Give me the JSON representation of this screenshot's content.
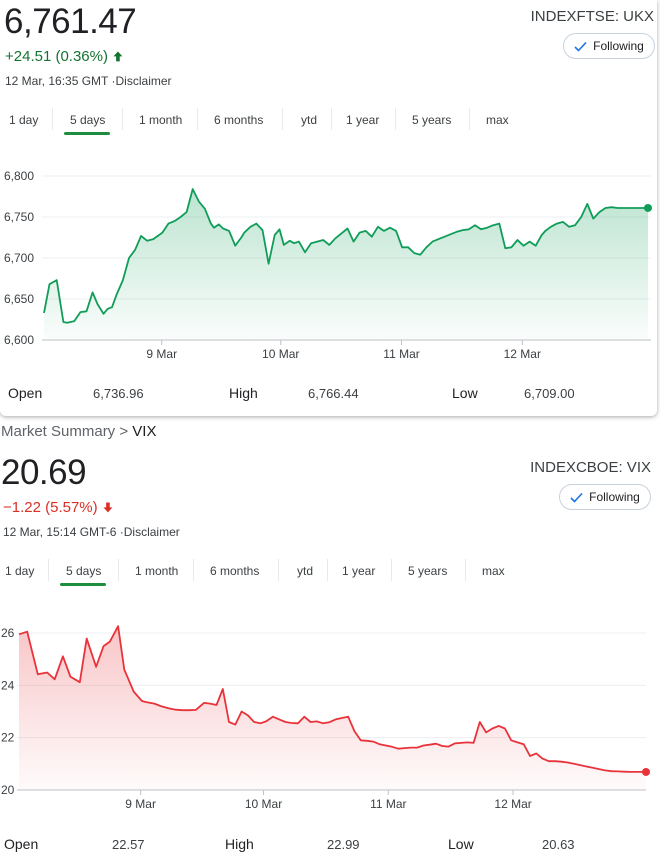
{
  "ukx": {
    "price": "6,761.47",
    "change": "+24.51 (0.36%)",
    "meta_time": "12 Mar, 16:35 GMT",
    "meta_sep": " ·",
    "meta_disclaimer": "Disclaimer",
    "ticker": "INDEXFTSE: UKX",
    "follow_label": "Following",
    "tabs": [
      "1 day",
      "5 days",
      "1 month",
      "6 months",
      "ytd",
      "1 year",
      "5 years",
      "max"
    ],
    "active_tab": "5 days",
    "stats": {
      "open_label": "Open",
      "open": "6,736.96",
      "high_label": "High",
      "high": "6,766.44",
      "low_label": "Low",
      "low": "6,709.00"
    },
    "colors": {
      "line": "#0f9d58",
      "text": "#137333"
    }
  },
  "breadcrumb": {
    "parent": "Market Summary",
    "sep": " > ",
    "current": "VIX"
  },
  "vix": {
    "price": "20.69",
    "change": "−1.22 (5.57%)",
    "meta_time": "12 Mar, 15:14 GMT-6",
    "meta_sep": " ·",
    "meta_disclaimer": "Disclaimer",
    "ticker": "INDEXCBOE: VIX",
    "follow_label": "Following",
    "tabs": [
      "1 day",
      "5 days",
      "1 month",
      "6 months",
      "ytd",
      "1 year",
      "5 years",
      "max"
    ],
    "active_tab": "5 days",
    "stats": {
      "open_label": "Open",
      "open": "22.57",
      "high_label": "High",
      "high": "22.99",
      "low_label": "Low",
      "low": "20.63"
    },
    "colors": {
      "line": "#e8333a",
      "text": "#d93025"
    }
  },
  "chart_data": [
    {
      "type": "line",
      "ylim": [
        6600,
        6800
      ],
      "yticks": [
        6600,
        6650,
        6700,
        6750,
        6800
      ],
      "ytick_labels": [
        "6,600",
        "6,650",
        "6,700",
        "6,750",
        "6,800"
      ],
      "xlim": [
        0,
        100
      ],
      "xticks": [
        19.4,
        39.0,
        58.9,
        78.8
      ],
      "xtick_labels": [
        "9 Mar",
        "10 Mar",
        "11 Mar",
        "12 Mar"
      ],
      "grid": true,
      "series": [
        {
          "x": [
            0,
            0.9,
            2.1,
            3.2,
            3.8,
            5.0,
            6.0,
            7.0,
            8.0,
            8.8,
            9.8,
            10.5,
            11.2,
            12.0,
            13.0,
            14.0,
            15.0,
            16.0,
            17.0,
            18.0,
            19.5,
            20.5,
            21.5,
            22.5,
            23.5,
            24.5,
            25.5,
            26.5,
            27.5,
            28.0,
            28.8,
            29.5,
            30.5,
            31.5,
            32.5,
            33.0,
            34.0,
            35.0,
            36.0,
            37.0,
            38.0,
            38.8,
            39.5,
            40.5,
            41.2,
            42.0,
            43.0,
            44.0,
            45.0,
            46.0,
            47.0,
            48.0,
            49.0,
            50.0,
            51.0,
            52.0,
            53.0,
            54.0,
            55.0,
            56.0,
            57.0,
            58.0,
            59.0,
            60.0,
            61.0,
            62.0,
            63.0,
            64.0,
            65.0,
            66.0,
            67.0,
            68.0,
            69.0,
            70.0,
            71.0,
            72.0,
            73.0,
            74.0,
            75.0,
            76.0,
            77.0,
            78.0,
            79.0,
            80.0,
            81.0,
            82.0,
            82.6,
            83.5,
            84.5,
            85.5,
            86.5,
            87.5,
            88.5,
            89.5,
            90.5,
            91.5,
            92.5,
            93.5,
            94.5,
            95.5,
            96.5,
            97.5,
            98.5,
            99.5
          ],
          "y": [
            6633,
            6668,
            6673,
            6622,
            6621,
            6623,
            6634,
            6635,
            6658,
            6644,
            6632,
            6638,
            6640,
            6656,
            6673,
            6700,
            6710,
            6727,
            6721,
            6723,
            6731,
            6742,
            6745,
            6750,
            6756,
            6784,
            6769,
            6760,
            6742,
            6737,
            6741,
            6736,
            6733,
            6715,
            6725,
            6731,
            6738,
            6742,
            6734,
            6693,
            6728,
            6735,
            6716,
            6721,
            6718,
            6720,
            6707,
            6718,
            6720,
            6722,
            6716,
            6724,
            6730,
            6736,
            6720,
            6731,
            6733,
            6726,
            6738,
            6733,
            6737,
            6733,
            6713,
            6713,
            6706,
            6704,
            6713,
            6720,
            6723,
            6726,
            6729,
            6732,
            6734,
            6735,
            6740,
            6735,
            6737,
            6740,
            6742,
            6712,
            6713,
            6722,
            6715,
            6720,
            6715,
            6728,
            6733,
            6738,
            6742,
            6744,
            6738,
            6740,
            6750,
            6766,
            6748,
            6756,
            6761,
            6762,
            6761,
            6761,
            6761,
            6761,
            6761,
            6761
          ],
          "end_marker": true
        }
      ]
    },
    {
      "type": "area",
      "ylim": [
        20,
        26
      ],
      "yticks": [
        20,
        22,
        24,
        26
      ],
      "ytick_labels": [
        "20",
        "22",
        "24",
        "26"
      ],
      "xlim": [
        0,
        100
      ],
      "xticks": [
        19.4,
        39.0,
        58.9,
        78.8
      ],
      "xtick_labels": [
        "9 Mar",
        "10 Mar",
        "11 Mar",
        "12 Mar"
      ],
      "grid": true,
      "series": [
        {
          "x": [
            0,
            1.3,
            3.0,
            4.5,
            5.7,
            7.0,
            8.2,
            9.7,
            10.8,
            12.3,
            13.5,
            14.5,
            15.8,
            16.8,
            18.3,
            19.6,
            20.3,
            21.6,
            22.7,
            23.9,
            25.0,
            26.1,
            27.2,
            28.2,
            29.5,
            30.5,
            31.5,
            32.5,
            33.5,
            34.5,
            35.5,
            36.5,
            37.5,
            38.5,
            39.4,
            40.5,
            41.5,
            42.5,
            43.5,
            44.5,
            45.5,
            46.5,
            47.5,
            48.5,
            49.5,
            50.5,
            51.5,
            52.5,
            53.5,
            54.5,
            55.5,
            56.5,
            57.5,
            58.5,
            59.5,
            60.5,
            61.5,
            62.5,
            63.5,
            64.5,
            65.5,
            66.5,
            67.5,
            68.5,
            69.5,
            70.5,
            71.5,
            72.5,
            73.5,
            74.5,
            75.5,
            76.5,
            77.5,
            78.5,
            79.5,
            80.5,
            81.5,
            82.5,
            83.5,
            84.5,
            85.5,
            86.5,
            87.5,
            88.5,
            89.5,
            90.5,
            91.5,
            92.5,
            93.5,
            94.5,
            95.5,
            96.5,
            97.5,
            98.5,
            99.5,
            100.0
          ],
          "y": [
            25.95,
            26.05,
            24.42,
            24.49,
            24.23,
            25.11,
            24.33,
            24.12,
            25.79,
            24.71,
            25.5,
            25.67,
            26.26,
            24.6,
            23.76,
            23.4,
            23.36,
            23.3,
            23.2,
            23.12,
            23.07,
            23.05,
            23.05,
            23.06,
            23.33,
            23.3,
            23.25,
            23.86,
            22.6,
            22.5,
            23.0,
            22.85,
            22.6,
            22.55,
            22.62,
            22.8,
            22.7,
            22.6,
            22.56,
            22.55,
            22.8,
            22.6,
            22.62,
            22.55,
            22.59,
            22.7,
            22.75,
            22.8,
            22.25,
            21.9,
            21.88,
            21.85,
            21.75,
            21.7,
            21.65,
            21.58,
            21.6,
            21.62,
            21.62,
            21.7,
            21.73,
            21.77,
            21.68,
            21.66,
            21.78,
            21.8,
            21.82,
            21.8,
            22.6,
            22.2,
            22.35,
            22.45,
            22.35,
            21.9,
            21.82,
            21.75,
            21.3,
            21.4,
            21.2,
            21.1,
            21.1,
            21.08,
            21.05,
            21.0,
            20.95,
            20.9,
            20.85,
            20.8,
            20.75,
            20.72,
            20.71,
            20.7,
            20.69,
            20.69,
            20.69,
            20.69
          ],
          "end_marker": true
        }
      ]
    }
  ]
}
